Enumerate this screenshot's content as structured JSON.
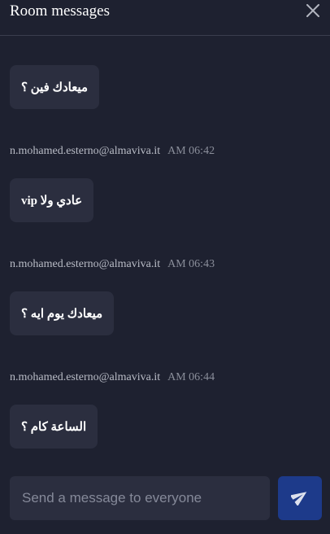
{
  "panel": {
    "title": "Room messages",
    "close_icon": "close-icon"
  },
  "messages": [
    {
      "sender": "",
      "time": "",
      "text": "ميعادك فين ؟"
    },
    {
      "sender": "n.mohamed.esterno@almaviva.it",
      "time": "AM 06:42",
      "text": "عادي ولا vip"
    },
    {
      "sender": "n.mohamed.esterno@almaviva.it",
      "time": "AM 06:43",
      "text": "ميعادك يوم ايه ؟"
    },
    {
      "sender": "n.mohamed.esterno@almaviva.it",
      "time": "AM 06:44",
      "text": "الساعة كام ؟"
    }
  ],
  "composer": {
    "placeholder": "Send a message to everyone",
    "value": "",
    "send_icon": "send-icon"
  },
  "colors": {
    "background": "#1e2130",
    "bubble": "#2b2e3f",
    "send_button": "#1d3a8a"
  }
}
